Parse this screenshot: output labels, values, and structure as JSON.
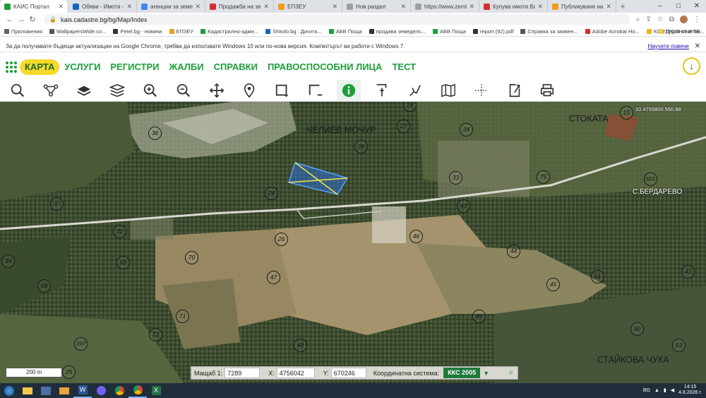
{
  "browser": {
    "tabs": [
      {
        "title": "КАИС Портал",
        "color": "#1e9e3a",
        "active": true
      },
      {
        "title": "Обяви - Имоти - търс",
        "color": "#1565c0"
      },
      {
        "title": "агенции за земеделс",
        "color": "#4285f4"
      },
      {
        "title": "Продажба на земеделс",
        "color": "#d32f2f"
      },
      {
        "title": "ЕПЗЕУ",
        "color": "#f29c1f"
      },
      {
        "title": "Нов раздел",
        "color": "#9aa0a6"
      },
      {
        "title": "https://www.zemi.bg/",
        "color": "#9aa0a6"
      },
      {
        "title": "Купува имоти Варна",
        "color": "#d32f2f"
      },
      {
        "title": "Публикуване на нова",
        "color": "#f29c1f"
      }
    ],
    "new_tab": "+",
    "url": "kais.cadastre.bg/bg/Map/Index",
    "bookmarks": [
      {
        "label": "Приложения",
        "color": "#5f6368"
      },
      {
        "label": "WallpapersWide.co...",
        "color": "#555"
      },
      {
        "label": "Petel.bg - новини",
        "color": "#333"
      },
      {
        "label": "ЕПЗЕУ",
        "color": "#f29c1f"
      },
      {
        "label": "Кадастрално-адми...",
        "color": "#1e9e3a"
      },
      {
        "label": "Shkolo.bg : Дигита...",
        "color": "#1565c0"
      },
      {
        "label": "АБВ Поща",
        "color": "#1e9e3a"
      },
      {
        "label": "продава земеделс...",
        "color": "#333"
      },
      {
        "label": "АБВ Поща",
        "color": "#1e9e3a"
      },
      {
        "label": "report (92).pdf",
        "color": "#333"
      },
      {
        "label": "Справка за заявен...",
        "color": "#555"
      },
      {
        "label": "Adobe Acrobat Ho...",
        "color": "#d32f2f"
      },
      {
        "label": "КОНТРОЛНИ И ТЕ...",
        "color": "#f2b01f"
      }
    ],
    "other_bookmarks": "Други отметки",
    "info_text": "За да получавате бъдещи актуализации на Google Chrome, трябва да използвате Windows 10 или по-нова версия. Компютърът ви работи с Windows 7.",
    "info_link": "Научете повече"
  },
  "app": {
    "menu": [
      "КАРТА",
      "УСЛУГИ",
      "РЕГИСТРИ",
      "ЖАЛБИ",
      "СПРАВКИ",
      "ПРАВОСПОСОБНИ ЛИЦА",
      "ТЕСТ"
    ],
    "tools": [
      "search-icon",
      "route-icon",
      "layers-icon",
      "stack-icon",
      "zoom-in-icon",
      "zoom-out-icon",
      "pan-icon",
      "location-icon",
      "select-rect-icon",
      "select-remove-icon",
      "info-icon",
      "draw-icon",
      "measure-icon",
      "book-icon",
      "crosshair-icon",
      "export-icon",
      "print-icon"
    ]
  },
  "map": {
    "places": [
      {
        "name": "ЧЕЛИЕВ МОЧУР",
        "big": true
      },
      {
        "name": "СТОКАТА",
        "big": true
      },
      {
        "name": "С.БЕРДАРЕВО",
        "big": false
      },
      {
        "name": "СТАЙКОВА ЧУКА",
        "big": true
      }
    ],
    "edge_label": "10 4755800.550.88",
    "parcels": [
      "36",
      "28",
      "27",
      "34",
      "15",
      "28",
      "33",
      "75",
      "501",
      "37",
      "24",
      "43",
      "32",
      "26",
      "46",
      "44",
      "39",
      "69",
      "70",
      "51",
      "41",
      "47",
      "45",
      "68",
      "71",
      "72",
      "49",
      "50",
      "53",
      "397",
      "48",
      "25"
    ],
    "scale": "200 m",
    "coords": {
      "scale_label": "Мащаб 1:",
      "scale_value": "7289",
      "x_label": "X:",
      "x_value": "4756042",
      "y_label": "Y:",
      "y_value": "670246",
      "system_label": "Координатна система:",
      "system_value": "ККС 2005"
    }
  },
  "taskbar": {
    "lang": "BG",
    "time": "14:15",
    "date": "4.8.2026 г."
  }
}
